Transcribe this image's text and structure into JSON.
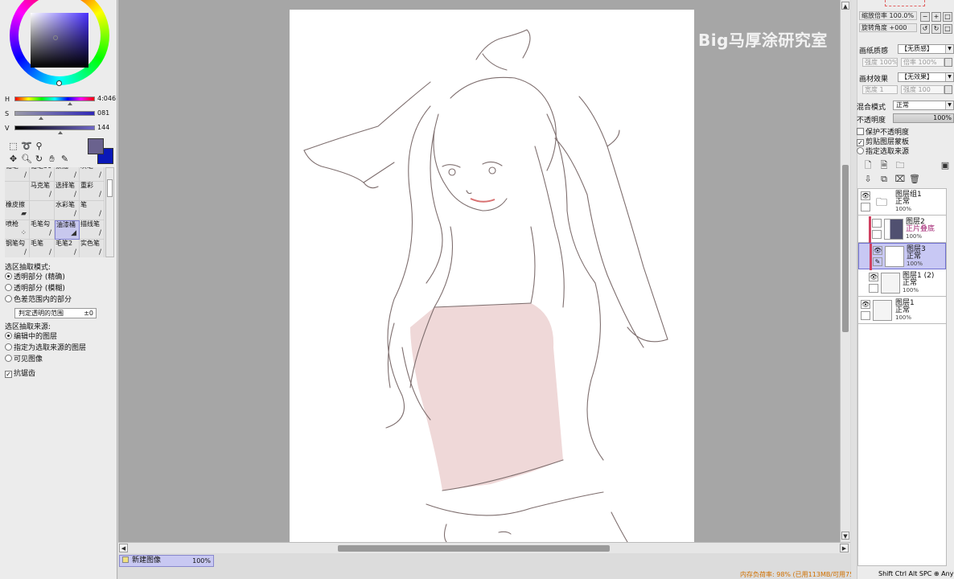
{
  "color_panel": {
    "h_label": "H",
    "h_value": "4:046",
    "s_label": "S",
    "s_value": "081",
    "v_label": "V",
    "v_value": "144",
    "main_color": "#6a628e",
    "sub_color": "#0a18b8"
  },
  "tools": [
    "select-rect-icon",
    "lasso-icon",
    "magic-wand-icon",
    "move-icon",
    "zoom-icon",
    "rotate-icon",
    "hand-icon",
    "eyedropper-icon"
  ],
  "brushes": [
    {
      "label": "铅笔"
    },
    {
      "label": "铅笔30"
    },
    {
      "label": "素描"
    },
    {
      "label": "灰笔"
    },
    {
      "label": ""
    },
    {
      "label": "马克笔"
    },
    {
      "label": "选择笔"
    },
    {
      "label": "重彩"
    },
    {
      "label": "橡皮擦"
    },
    {
      "label": ""
    },
    {
      "label": "水彩笔"
    },
    {
      "label": "笔"
    },
    {
      "label": "喷枪"
    },
    {
      "label": "毛笔勾"
    },
    {
      "label": "油漆桶"
    },
    {
      "label": "描线笔"
    },
    {
      "label": "钢笔勾"
    },
    {
      "label": "毛笔"
    },
    {
      "label": "毛笔2"
    },
    {
      "label": "实色笔"
    }
  ],
  "selection_options": {
    "mode_title": "选区抽取模式:",
    "mode_opt1": "透明部分 (精确)",
    "mode_opt2": "透明部分 (模糊)",
    "mode_opt3": "色差范围内的部分",
    "range_label": "判定透明的范围",
    "range_value": "±0",
    "source_title": "选区抽取来源:",
    "source_opt1": "编辑中的图层",
    "source_opt2": "指定为选取来源的图层",
    "source_opt3": "可见图像",
    "antialias": "抗锯齿"
  },
  "document_tab": {
    "name": "新建图像",
    "zoom": "100%"
  },
  "watermark": "Big马厚涂研究室",
  "status": {
    "memory": "内存负荷率: 98% (已用113MB/可用758MB)",
    "keys": "Shift Ctrl Alt SPC ⊕ Any"
  },
  "right_panel": {
    "zoom_label": "缩放倍率",
    "zoom_value": "100.0%",
    "angle_label": "旋转角度",
    "angle_value": "+000",
    "paper_label": "画纸质感",
    "paper_value": "【无质感】",
    "paper_strength": "强度",
    "paper_strength_val": "100%",
    "paper_scale": "倍率",
    "paper_scale_val": "100%",
    "material_label": "画材效果",
    "material_value": "【无效果】",
    "material_width": "宽度",
    "material_width_val": "1",
    "material_strength": "强度",
    "material_strength_val": "100",
    "blend_label": "混合模式",
    "blend_value": "正常",
    "opacity_label": "不透明度",
    "opacity_value": "100%",
    "protect_opacity": "保护不透明度",
    "clip_mask": "剪贴图层蒙板",
    "select_source": "指定选取来源"
  },
  "layers": [
    {
      "name": "图层组1",
      "mode": "正常",
      "opacity": "100%",
      "type": "folder"
    },
    {
      "name": "图层2",
      "mode": "正片叠底",
      "opacity": "100%",
      "type": "clipped"
    },
    {
      "name": "图层3",
      "mode": "正常",
      "opacity": "100%",
      "type": "selected"
    },
    {
      "name": "图层1 (2)",
      "mode": "正常",
      "opacity": "100%",
      "type": "normal"
    },
    {
      "name": "图层1",
      "mode": "正常",
      "opacity": "100%",
      "type": "normal"
    }
  ]
}
